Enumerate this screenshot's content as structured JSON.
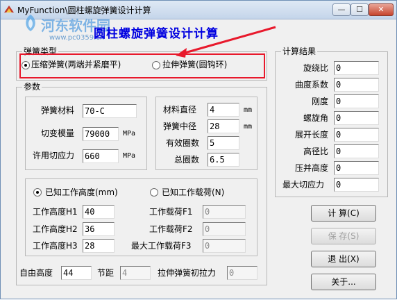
{
  "window": {
    "title": "MyFunction\\圆柱螺旋弹簧设计计算",
    "min_glyph": "—",
    "max_glyph": "☐",
    "close_glyph": "✕"
  },
  "watermark": {
    "text": "河东软件园",
    "url": "www.pc0359.cn"
  },
  "heading": "圆柱螺旋弹簧设计计算",
  "spring_type": {
    "legend": "弹簧类型",
    "options": [
      {
        "label": "压缩弹簧(两端并紧磨平)",
        "selected": true
      },
      {
        "label": "拉伸弹簧(圆钩环)",
        "selected": false
      }
    ]
  },
  "params": {
    "legend": "参数",
    "material_label": "弹簧材料",
    "material_value": "70-C",
    "shear_modulus_label": "切变模量",
    "shear_modulus_value": "79000",
    "shear_modulus_unit": "MPa",
    "allow_stress_label": "许用切应力",
    "allow_stress_value": "660",
    "allow_stress_unit": "MPa",
    "wire_dia_label": "材料直径",
    "wire_dia_value": "4",
    "wire_dia_unit": "mm",
    "mean_dia_label": "弹簧中径",
    "mean_dia_value": "28",
    "mean_dia_unit": "mm",
    "active_coils_label": "有效圈数",
    "active_coils_value": "5",
    "total_coils_label": "总圈数",
    "total_coils_value": "6.5"
  },
  "work": {
    "known_height_label": "已知工作高度(mm)",
    "known_height_selected": true,
    "known_load_label": "已知工作载荷(N)",
    "known_load_selected": false,
    "h1_label": "工作高度H1",
    "h1_value": "40",
    "h2_label": "工作高度H2",
    "h2_value": "36",
    "h3_label": "工作高度H3",
    "h3_value": "28",
    "f1_label": "工作载荷F1",
    "f1_value": "0",
    "f2_label": "工作载荷F2",
    "f2_value": "0",
    "f3_label": "最大工作载荷F3",
    "f3_value": "0"
  },
  "bottom": {
    "free_height_label": "自由高度",
    "free_height_value": "44",
    "pitch_label": "节距",
    "pitch_value": "4",
    "init_tension_label": "拉伸弹簧初拉力",
    "init_tension_value": "0"
  },
  "results": {
    "legend": "计算结果",
    "rows": [
      {
        "label": "旋绕比",
        "value": "0"
      },
      {
        "label": "曲度系数",
        "value": "0"
      },
      {
        "label": "刚度",
        "value": "0"
      },
      {
        "label": "螺旋角",
        "value": "0"
      },
      {
        "label": "展开长度",
        "value": "0"
      },
      {
        "label": "高径比",
        "value": "0"
      },
      {
        "label": "压并高度",
        "value": "0"
      },
      {
        "label": "最大切应力",
        "value": "0"
      }
    ]
  },
  "buttons": {
    "calc": "计 算(C)",
    "save": "保 存(S)",
    "exit": "退 出(X)",
    "about": "关于..."
  },
  "colors": {
    "heading": "#0000e0",
    "annotation_red": "#e8192c"
  }
}
